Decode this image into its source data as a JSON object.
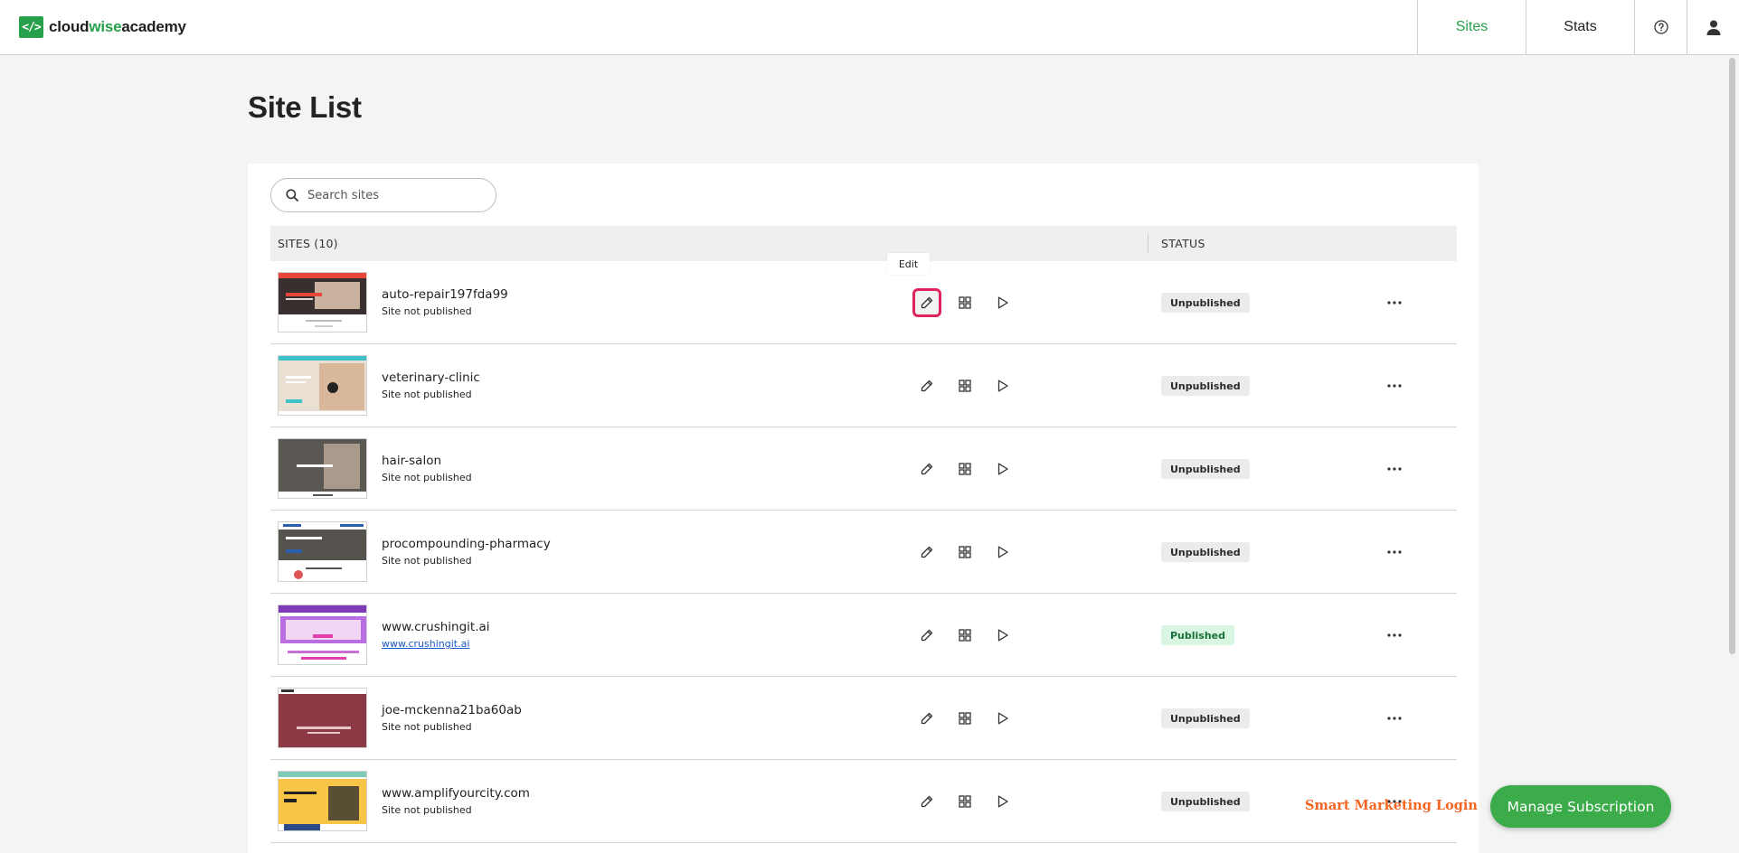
{
  "app": {
    "brand_prefix": "cloud",
    "brand_mid": "wise",
    "brand_suffix": "academy",
    "logo_glyph": "</>",
    "accent": "#26a04a"
  },
  "nav": {
    "sites": "Sites",
    "stats": "Stats",
    "help_icon": "question-circle-icon",
    "user_icon": "user-icon"
  },
  "page": {
    "title": "Site List"
  },
  "search": {
    "placeholder": "Search sites",
    "value": ""
  },
  "table": {
    "col_sites": "SITES (10)",
    "col_status": "STATUS"
  },
  "tooltip": {
    "edit": "Edit"
  },
  "sites": [
    {
      "name": "auto-repair197fda99",
      "sub": "Site not published",
      "sub_is_link": false,
      "status": "Unpublished"
    },
    {
      "name": "veterinary-clinic",
      "sub": "Site not published",
      "sub_is_link": false,
      "status": "Unpublished"
    },
    {
      "name": "hair-salon",
      "sub": "Site not published",
      "sub_is_link": false,
      "status": "Unpublished"
    },
    {
      "name": "procompounding-pharmacy",
      "sub": "Site not published",
      "sub_is_link": false,
      "status": "Unpublished"
    },
    {
      "name": "www.crushingit.ai",
      "sub": "www.crushingit.ai",
      "sub_is_link": true,
      "status": "Published"
    },
    {
      "name": "joe-mckenna21ba60ab",
      "sub": "Site not published",
      "sub_is_link": false,
      "status": "Unpublished"
    },
    {
      "name": "www.amplifyourcity.com",
      "sub": "Site not published",
      "sub_is_link": false,
      "status": "Unpublished"
    }
  ],
  "footer": {
    "smart_login": "Smart Marketing Login",
    "manage_subscription": "Manage Subscription",
    "manage_color": "#3cab4a",
    "login_color": "#f26522"
  }
}
